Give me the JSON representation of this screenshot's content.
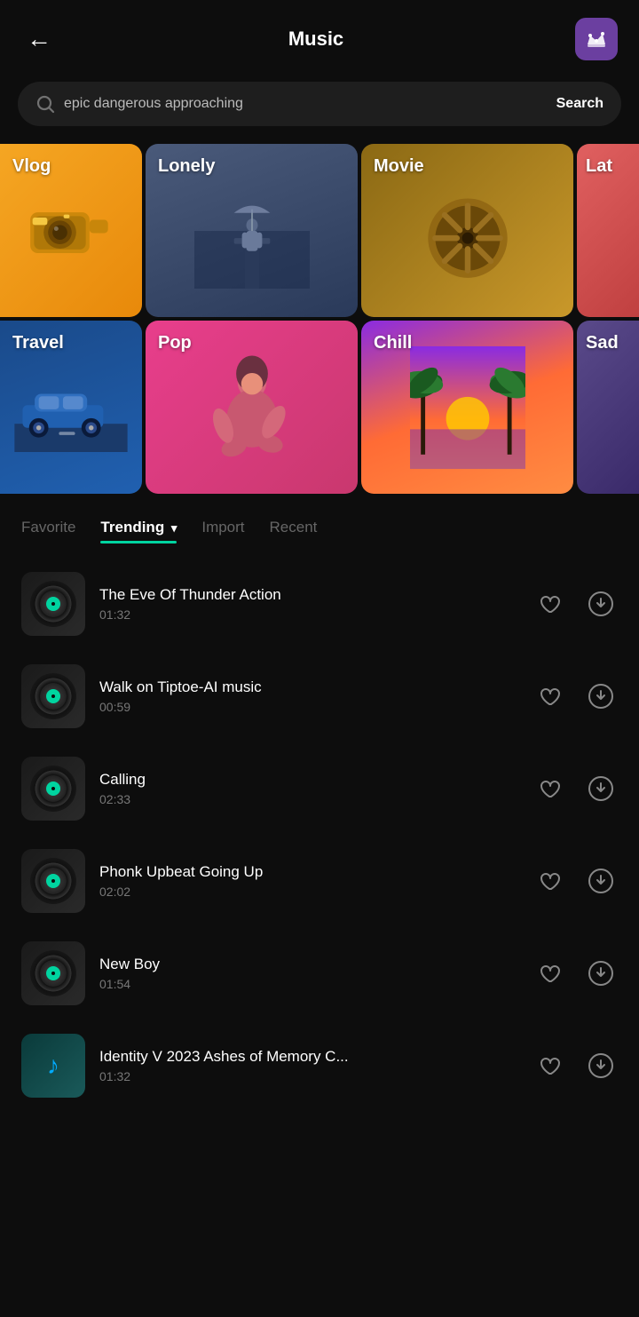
{
  "header": {
    "back_label": "←",
    "title": "Music",
    "crown_label": "premium"
  },
  "search": {
    "placeholder": "epic dangerous approaching",
    "button_label": "Search",
    "icon": "search-icon"
  },
  "categories": {
    "row1": [
      {
        "id": "vlog",
        "label": "Vlog",
        "theme": "vlog",
        "partial": "left"
      },
      {
        "id": "lonely",
        "label": "Lonely",
        "theme": "lonely"
      },
      {
        "id": "movie",
        "label": "Movie",
        "theme": "movie"
      },
      {
        "id": "lat",
        "label": "Lat",
        "theme": "lat",
        "partial": "right"
      }
    ],
    "row2": [
      {
        "id": "travel",
        "label": "Travel",
        "theme": "travel",
        "partial": "left"
      },
      {
        "id": "pop",
        "label": "Pop",
        "theme": "pop"
      },
      {
        "id": "chill",
        "label": "Chill",
        "theme": "chill"
      },
      {
        "id": "sad",
        "label": "Sad",
        "theme": "sad",
        "partial": "right"
      }
    ]
  },
  "tabs": [
    {
      "id": "favorite",
      "label": "Favorite",
      "active": false
    },
    {
      "id": "trending",
      "label": "Trending",
      "active": true,
      "hasChevron": true
    },
    {
      "id": "import",
      "label": "Import",
      "active": false
    },
    {
      "id": "recent",
      "label": "Recent",
      "active": false
    }
  ],
  "tracks": [
    {
      "id": 1,
      "name": "The Eve Of Thunder Action",
      "duration": "01:32",
      "thumb_type": "vinyl"
    },
    {
      "id": 2,
      "name": "Walk on Tiptoe-AI music",
      "duration": "00:59",
      "thumb_type": "vinyl"
    },
    {
      "id": 3,
      "name": "Calling",
      "duration": "02:33",
      "thumb_type": "vinyl"
    },
    {
      "id": 4,
      "name": "Phonk Upbeat Going Up",
      "duration": "02:02",
      "thumb_type": "vinyl"
    },
    {
      "id": 5,
      "name": "New Boy",
      "duration": "01:54",
      "thumb_type": "vinyl"
    },
    {
      "id": 6,
      "name": "Identity V 2023 Ashes of Memory C...",
      "duration": "01:32",
      "thumb_type": "note"
    }
  ],
  "colors": {
    "accent": "#00d4a0",
    "bg": "#0d0d0d",
    "card_bg": "#1e1e1e",
    "text_primary": "#ffffff",
    "text_secondary": "#777777",
    "purple": "#6b3fa0"
  }
}
